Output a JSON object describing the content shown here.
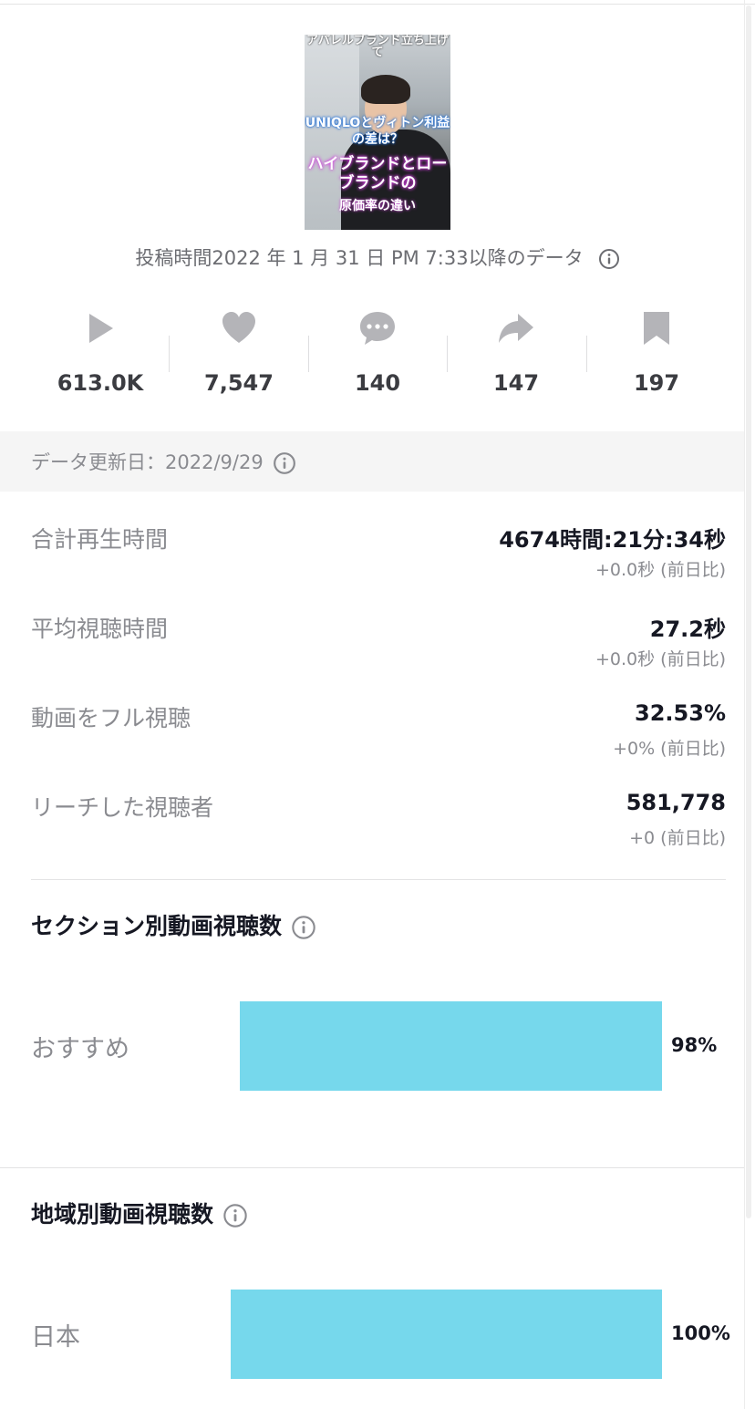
{
  "video": {
    "thumb_line1": "アパレルブランド立ち上げて",
    "thumb_line2": "UNIQLOとヴィトン利益の差は？",
    "thumb_line3": "ハイブランドとローブランドの",
    "thumb_line4": "原価率の違い",
    "posted_text": "投稿時間2022 年 1 月 31 日 PM 7:33以降のデータ"
  },
  "stats": [
    {
      "icon": "play-icon",
      "value": "613.0K"
    },
    {
      "icon": "heart-icon",
      "value": "7,547"
    },
    {
      "icon": "comment-icon",
      "value": "140"
    },
    {
      "icon": "share-icon",
      "value": "147"
    },
    {
      "icon": "bookmark-icon",
      "value": "197"
    }
  ],
  "updated": {
    "text": "データ更新日：2022/9/29"
  },
  "metrics": [
    {
      "label": "合計再生時間",
      "value": "4674時間:21分:34秒",
      "delta": "+0.0秒 (前日比)"
    },
    {
      "label": "平均視聴時間",
      "value": "27.2秒",
      "delta": "+0.0秒 (前日比)"
    },
    {
      "label": "動画をフル視聴",
      "value": "32.53%",
      "delta": "+0% (前日比)"
    },
    {
      "label": "リーチした視聴者",
      "value": "581,778",
      "delta": "+0 (前日比)"
    }
  ],
  "section_views": {
    "title": "セクション別動画視聴数",
    "rows": [
      {
        "category": "おすすめ",
        "percent_label": "98%",
        "share": 0.98
      }
    ]
  },
  "region_views": {
    "title": "地域別動画視聴数",
    "rows": [
      {
        "category": "日本",
        "percent_label": "100%",
        "share": 1.0
      }
    ]
  },
  "colors": {
    "bar": "#76d8ec",
    "icon_gray": "#b4b4b8",
    "text_gray": "#8a8b90"
  }
}
